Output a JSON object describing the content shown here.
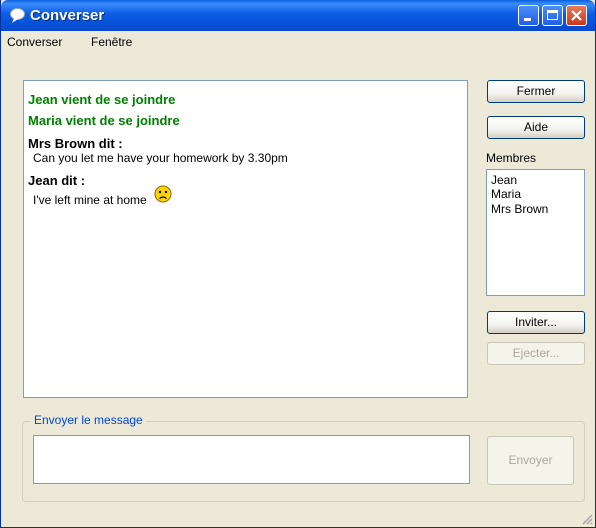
{
  "window": {
    "title": "Converser"
  },
  "menu": {
    "items": [
      "Converser",
      "Fenêtre"
    ]
  },
  "conversation": {
    "join1": "Jean vient de se joindre",
    "join2": "Maria vient de se joindre",
    "speaker1": "Mrs Brown dit :",
    "message1": "Can you let me have your homework by 3.30pm",
    "speaker2": "Jean dit :",
    "message2": "I've left mine at home",
    "emoticon": "sad-face"
  },
  "buttons": {
    "close": "Fermer",
    "help": "Aide",
    "invite": "Inviter...",
    "eject": "Ejecter...",
    "send": "Envoyer"
  },
  "members": {
    "label": "Membres",
    "items": [
      "Jean",
      "Maria",
      "Mrs Brown"
    ]
  },
  "compose": {
    "label": "Envoyer le message",
    "value": ""
  },
  "colors": {
    "join_text": "#008000",
    "title_bar": "#0a5fe0",
    "group_label": "#0046d5"
  }
}
